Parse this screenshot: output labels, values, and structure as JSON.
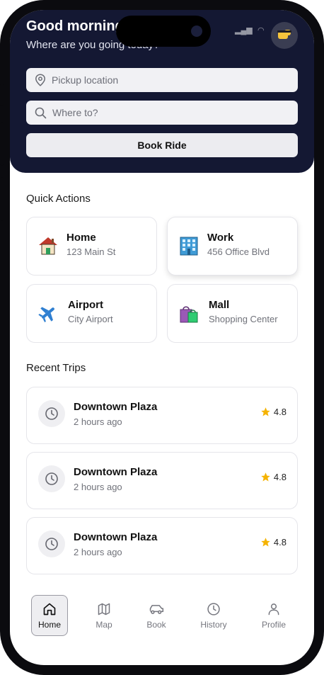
{
  "header": {
    "greeting": "Good morning",
    "subtitle": "Where are you going today?",
    "pickup_placeholder": "Pickup location",
    "destination_placeholder": "Where to?",
    "book_label": "Book Ride"
  },
  "quick_actions": {
    "title": "Quick Actions",
    "items": [
      {
        "title": "Home",
        "subtitle": "123 Main St",
        "icon": "house-icon"
      },
      {
        "title": "Work",
        "subtitle": "456 Office Blvd",
        "icon": "office-building-icon"
      },
      {
        "title": "Airport",
        "subtitle": "City Airport",
        "icon": "airplane-icon"
      },
      {
        "title": "Mall",
        "subtitle": "Shopping Center",
        "icon": "shopping-bags-icon"
      }
    ]
  },
  "recent_trips": {
    "title": "Recent Trips",
    "items": [
      {
        "destination": "Downtown Plaza",
        "time": "2 hours ago",
        "rating": "4.8"
      },
      {
        "destination": "Downtown Plaza",
        "time": "2 hours ago",
        "rating": "4.8"
      },
      {
        "destination": "Downtown Plaza",
        "time": "2 hours ago",
        "rating": "4.8"
      }
    ]
  },
  "tabs": [
    {
      "label": "Home",
      "icon": "home-icon",
      "active": true
    },
    {
      "label": "Map",
      "icon": "map-icon",
      "active": false
    },
    {
      "label": "Book",
      "icon": "car-icon",
      "active": false
    },
    {
      "label": "History",
      "icon": "clock-icon",
      "active": false
    },
    {
      "label": "Profile",
      "icon": "user-icon",
      "active": false
    }
  ],
  "colors": {
    "header_bg": "#141833",
    "rating_star": "#f5b301",
    "active_tab_bg": "#eeeef1"
  }
}
